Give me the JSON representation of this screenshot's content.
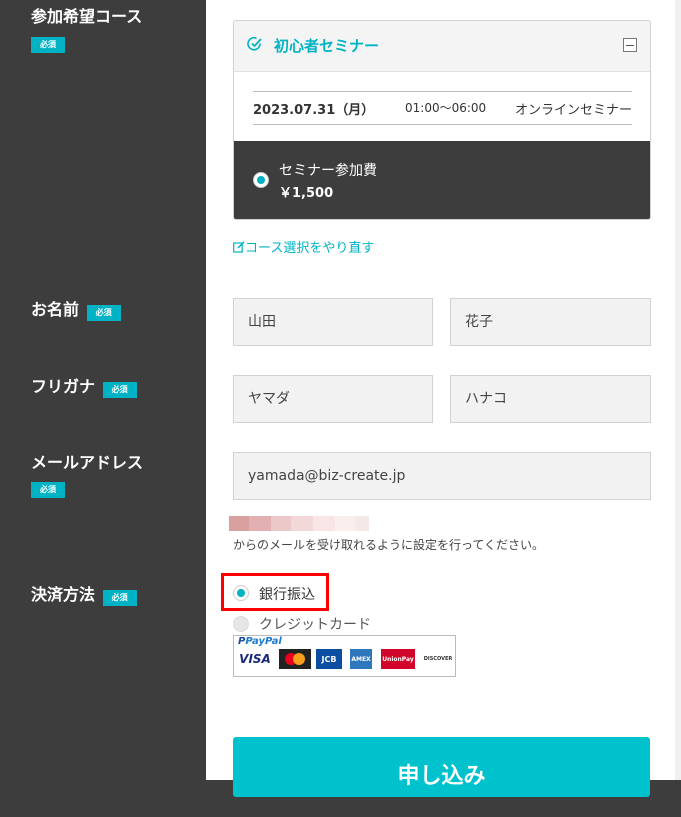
{
  "sidebar": {
    "course_label": "参加希望コース",
    "name_label": "お名前",
    "kana_label": "フリガナ",
    "email_label": "メールアドレス",
    "payment_label": "決済方法",
    "required_badge": "必須"
  },
  "course": {
    "title": "初心者セミナー",
    "date": "2023.07.31（月）",
    "time": "01:00〜06:00",
    "type": "オンラインセミナー",
    "fee_label": "セミナー参加費",
    "fee_value": "￥1,500",
    "redo_link": "コース選択をやり直す"
  },
  "form": {
    "last_name": "山田",
    "first_name": "花子",
    "last_kana": "ヤマダ",
    "first_kana": "ハナコ",
    "email": "yamada@biz-create.jp",
    "email_note": "からのメールを受け取れるように設定を行ってください。"
  },
  "payment": {
    "option_bank": "銀行振込",
    "option_card": "クレジットカード",
    "paypal_text": "PayPal",
    "visa": "VISA",
    "jcb": "JCB",
    "amex": "AMEX",
    "unionpay": "UnionPay",
    "discover": "DISCOVER"
  },
  "submit": {
    "label": "申し込み"
  },
  "colors": {
    "accent": "#00b3c4",
    "sidebar": "#3d3d3d",
    "highlight": "#ff0000"
  }
}
